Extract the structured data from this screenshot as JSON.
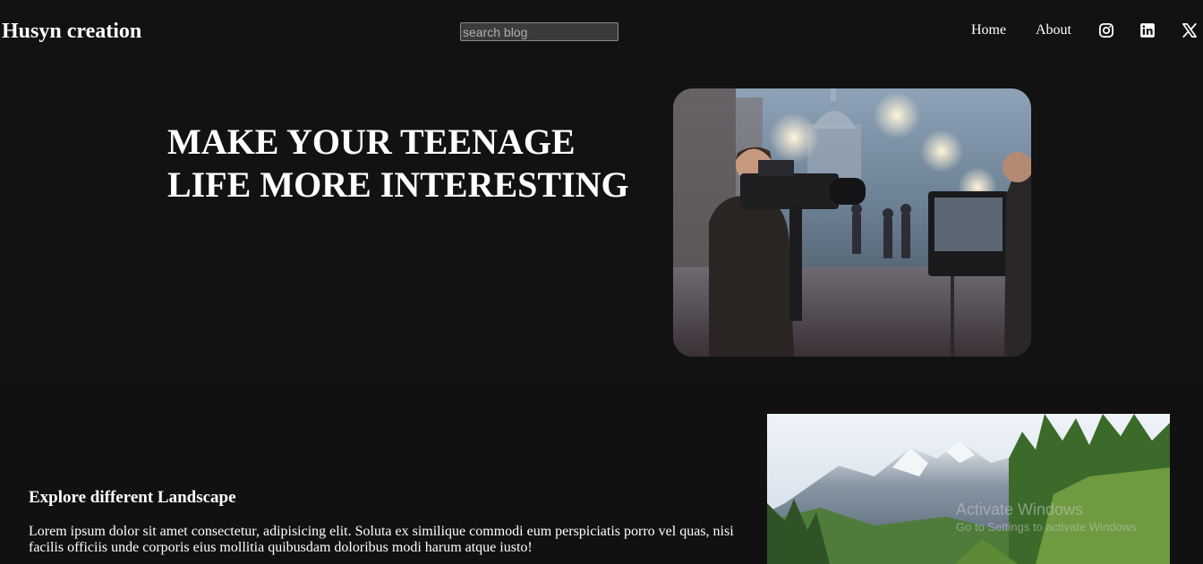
{
  "navbar": {
    "brand": "Husyn creation",
    "search_placeholder": "search blog",
    "links": {
      "home": "Home",
      "about": "About"
    },
    "social_icons": [
      "instagram-icon",
      "linkedin-icon",
      "x-icon"
    ]
  },
  "hero": {
    "title_line1": "MAKE YOUR TEENAGE",
    "title_line2": "LIFE MORE INTERESTING",
    "image": "film-crew-photo"
  },
  "section": {
    "heading": "Explore different Landscape",
    "body": "Lorem ipsum dolor sit amet consectetur, adipisicing elit. Soluta ex similique commodi eum perspiciatis porro vel quas, nisi facilis officiis unde corporis eius mollitia quibusdam doloribus modi harum atque iusto!",
    "image": "mountain-landscape-photo"
  },
  "watermark": {
    "title": "Activate Windows",
    "subtitle": "Go to Settings to activate Windows."
  },
  "colors": {
    "background": "#111111",
    "text": "#ffffff",
    "search_bg": "#3b3b3b"
  }
}
